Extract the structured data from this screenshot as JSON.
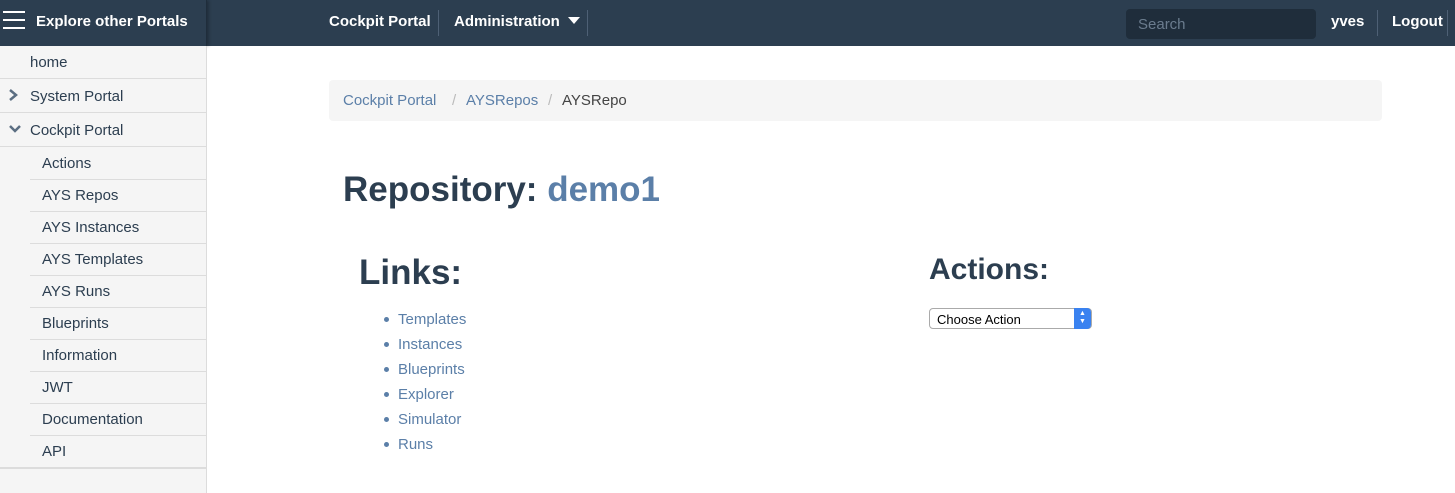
{
  "topbar": {
    "brand": "Explore other Portals",
    "nav": [
      "Cockpit Portal",
      "Administration"
    ],
    "search_placeholder": "Search",
    "user": "yves",
    "logout": "Logout"
  },
  "sidebar": {
    "items": [
      {
        "label": "home"
      },
      {
        "label": "System Portal"
      },
      {
        "label": "Cockpit Portal"
      }
    ],
    "subitems": [
      "Actions",
      "AYS Repos",
      "AYS Instances",
      "AYS Templates",
      "AYS Runs",
      "Blueprints",
      "Information",
      "JWT",
      "Documentation",
      "API"
    ]
  },
  "breadcrumb": {
    "items": [
      "Cockpit Portal",
      "AYSRepos",
      "AYSRepo"
    ],
    "divider": "/"
  },
  "main": {
    "title_prefix": "Repository:",
    "repo_name": "demo1",
    "links_heading": "Links:",
    "actions_heading": "Actions:",
    "links": [
      "Templates",
      "Instances",
      "Blueprints",
      "Explorer",
      "Simulator",
      "Runs"
    ],
    "action_select": "Choose Action"
  },
  "colors": {
    "topbar": "#2c3e50",
    "link": "#5b7fa8",
    "sidebar_bg": "#f5f5f5"
  },
  "icons": {
    "menu": "hamburger-icon",
    "dropdown": "caret-down-icon",
    "collapsed": "chevron-right-icon",
    "expanded": "chevron-down-icon"
  }
}
